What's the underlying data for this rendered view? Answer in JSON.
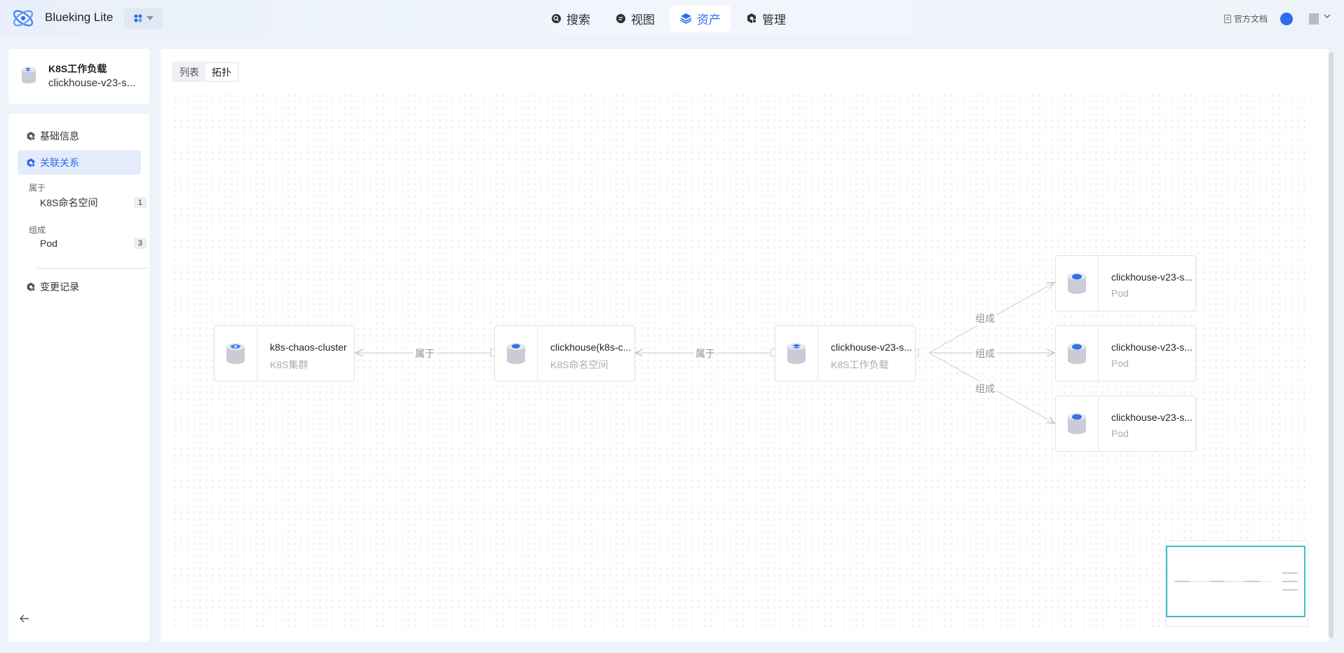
{
  "header": {
    "brand": "Blueking Lite",
    "nav": [
      {
        "label": "搜索",
        "icon": "search-icon"
      },
      {
        "label": "视图",
        "icon": "view-icon"
      },
      {
        "label": "资产",
        "icon": "layers-icon",
        "active": true
      },
      {
        "label": "管理",
        "icon": "settings-icon"
      }
    ],
    "doc_link": "官方文档"
  },
  "object": {
    "type": "K8S工作负载",
    "name": "clickhouse-v23-s..."
  },
  "sidebar": {
    "basic_info": "基础信息",
    "relations": "关联关系",
    "groups": [
      {
        "label": "属于",
        "items": [
          {
            "label": "K8S命名空间",
            "count": "1"
          }
        ]
      },
      {
        "label": "组成",
        "items": [
          {
            "label": "Pod",
            "count": "3"
          }
        ]
      }
    ],
    "change_log": "变更记录"
  },
  "view_toggle": {
    "list": "列表",
    "topology": "拓扑",
    "active": "topology"
  },
  "topology": {
    "nodes": [
      {
        "name": "k8s-chaos-cluster",
        "type": "K8S集群"
      },
      {
        "name": "clickhouse(k8s-c...",
        "type": "K8S命名空间"
      },
      {
        "name": "clickhouse-v23-s...",
        "type": "K8S工作负载"
      },
      {
        "name": "clickhouse-v23-s...",
        "type": "Pod"
      },
      {
        "name": "clickhouse-v23-s...",
        "type": "Pod"
      },
      {
        "name": "clickhouse-v23-s...",
        "type": "Pod"
      }
    ],
    "edges": [
      {
        "label": "属于"
      },
      {
        "label": "属于"
      },
      {
        "label": "组成"
      },
      {
        "label": "组成"
      },
      {
        "label": "组成"
      }
    ]
  },
  "colors": {
    "accent": "#2f6bf0",
    "minimap_border": "#3fbfc7"
  }
}
